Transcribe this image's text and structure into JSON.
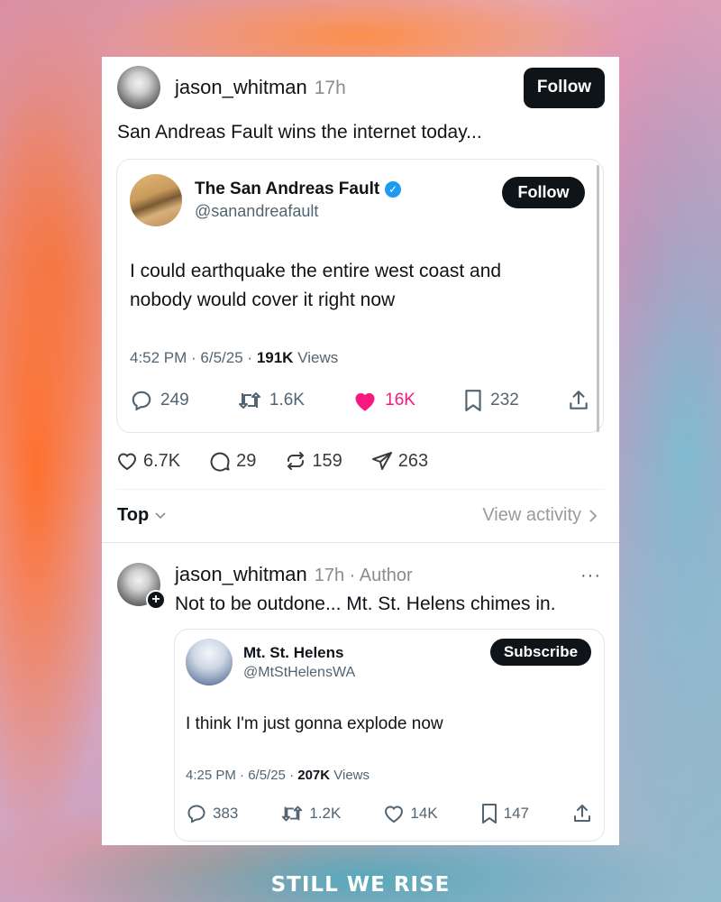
{
  "post": {
    "username": "jason_whitman",
    "time": "17h",
    "follow_label": "Follow",
    "text": "San Andreas Fault wins the internet today...",
    "stats": {
      "likes": "6.7K",
      "replies": "29",
      "reposts": "159",
      "shares": "263"
    }
  },
  "quoted_tweet": {
    "display_name": "The San Andreas Fault",
    "handle": "@sanandreafault",
    "follow_label": "Follow",
    "text": "I could earthquake the entire west coast and nobody would cover it right now",
    "meta_time": "4:52 PM · 6/5/25 ·",
    "views_count": "191K",
    "views_label": "Views",
    "replies": "249",
    "retweets": "1.6K",
    "likes": "16K",
    "bookmarks": "232",
    "like_color": "#f91880"
  },
  "sort": {
    "label": "Top",
    "view_activity": "View activity"
  },
  "reply": {
    "username": "jason_whitman",
    "time": "17h · Author",
    "more": "···",
    "text": "Not to be outdone... Mt. St. Helens chimes in.",
    "quoted": {
      "display_name": "Mt. St. Helens",
      "handle": "@MtStHelensWA",
      "subscribe_label": "Subscribe",
      "text": "I think I'm just gonna explode now",
      "meta_time": "4:25 PM · 6/5/25 ·",
      "views_count": "207K",
      "views_label": "Views",
      "replies": "383",
      "retweets": "1.2K",
      "likes": "14K",
      "bookmarks": "147"
    }
  },
  "brand": "STILL WE RISE"
}
